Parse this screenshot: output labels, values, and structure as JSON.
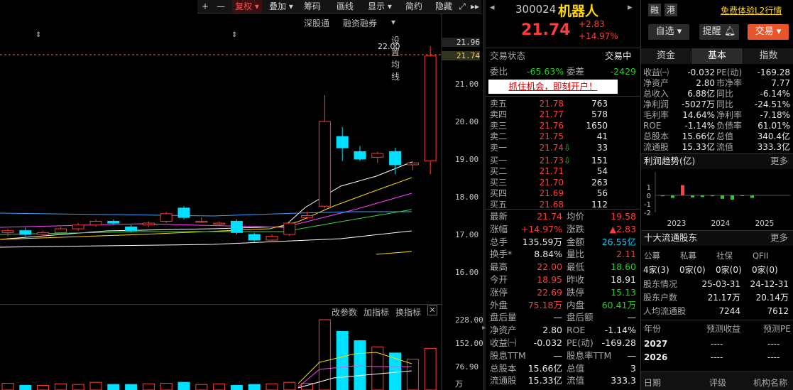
{
  "toolbar": {
    "items": [
      "+",
      "—",
      "复权",
      "叠加",
      "筹码",
      "画线",
      "显示",
      "简约",
      "隐藏"
    ]
  },
  "subbar": {
    "items": [
      "深股通",
      "融资融券",
      "设置均线"
    ]
  },
  "price_axis": {
    "labels": [
      "22.00",
      "21.00",
      "20.00",
      "19.00",
      "18.00",
      "17.00",
      "16.00"
    ],
    "tags": [
      "21.96",
      "21.74"
    ],
    "high_marker": "22.00"
  },
  "volume_bar": {
    "items": [
      "改参数",
      "加指标",
      "换指标"
    ],
    "labels": [
      "228.00",
      "152.00",
      "76.90",
      "万"
    ]
  },
  "chart_data": {
    "type": "candlestick",
    "candles": [
      {
        "o": 17.05,
        "c": 17.1,
        "h": 17.15,
        "l": 16.95
      },
      {
        "o": 17.1,
        "c": 17.0,
        "h": 17.18,
        "l": 16.95
      },
      {
        "o": 17.0,
        "c": 17.05,
        "h": 17.1,
        "l": 16.95
      },
      {
        "o": 17.05,
        "c": 17.15,
        "h": 17.2,
        "l": 17.0
      },
      {
        "o": 17.15,
        "c": 17.25,
        "h": 17.3,
        "l": 17.1
      },
      {
        "o": 17.25,
        "c": 17.35,
        "h": 17.4,
        "l": 17.2
      },
      {
        "o": 17.35,
        "c": 17.3,
        "h": 17.4,
        "l": 17.25
      },
      {
        "o": 17.2,
        "c": 17.1,
        "h": 17.25,
        "l": 17.05
      },
      {
        "o": 17.25,
        "c": 17.3,
        "h": 17.35,
        "l": 17.2
      },
      {
        "o": 17.35,
        "c": 17.55,
        "h": 17.6,
        "l": 17.3
      },
      {
        "o": 17.7,
        "c": 17.45,
        "h": 17.75,
        "l": 17.4
      },
      {
        "o": 17.35,
        "c": 17.35,
        "h": 17.45,
        "l": 17.3
      },
      {
        "o": 17.3,
        "c": 17.3,
        "h": 17.35,
        "l": 17.25
      },
      {
        "o": 17.35,
        "c": 17.05,
        "h": 17.4,
        "l": 17.0
      },
      {
        "o": 17.0,
        "c": 16.85,
        "h": 17.05,
        "l": 16.8
      },
      {
        "o": 16.85,
        "c": 16.95,
        "h": 17.0,
        "l": 16.8
      },
      {
        "o": 17.0,
        "c": 17.3,
        "h": 17.35,
        "l": 16.95
      },
      {
        "o": 17.45,
        "c": 17.5,
        "h": 17.6,
        "l": 17.4
      },
      {
        "o": 17.75,
        "c": 20.0,
        "h": 20.7,
        "l": 17.7
      },
      {
        "o": 19.6,
        "c": 19.3,
        "h": 19.85,
        "l": 18.95
      },
      {
        "o": 19.2,
        "c": 19.0,
        "h": 19.35,
        "l": 18.95
      },
      {
        "o": 19.05,
        "c": 19.15,
        "h": 19.2,
        "l": 18.9
      },
      {
        "o": 19.2,
        "c": 18.85,
        "h": 19.3,
        "l": 18.6
      },
      {
        "o": 18.85,
        "c": 18.9,
        "h": 18.95,
        "l": 18.7
      },
      {
        "o": 18.95,
        "c": 21.74,
        "h": 22.0,
        "l": 18.6
      }
    ],
    "volume": [
      22,
      15,
      15,
      20,
      18,
      25,
      18,
      18,
      20,
      22,
      25,
      18,
      20,
      15,
      18,
      20,
      25,
      22,
      228,
      190,
      160,
      140,
      120,
      100,
      135
    ]
  },
  "quote": {
    "code": "300024",
    "name": "机器人",
    "price": "21.74",
    "change": "+2.83",
    "pct": "+14.97%",
    "btn_zixuan": "自选",
    "btn_tixing": "提醒",
    "btn_jiaoyi": "交易",
    "state_label": "交易状态",
    "state_value": "交易中",
    "weibi_label": "委比",
    "weibi": "-65.63%",
    "weicha_label": "委差",
    "weicha": "-2429",
    "ad": "抓住机会，即刻开户！",
    "sells": [
      {
        "label": "卖五",
        "price": "21.78",
        "vol": "763"
      },
      {
        "label": "卖四",
        "price": "21.77",
        "vol": "578"
      },
      {
        "label": "卖三",
        "price": "21.76",
        "vol": "1650"
      },
      {
        "label": "卖二",
        "price": "21.75",
        "vol": "41"
      },
      {
        "label": "卖一",
        "price": "21.74",
        "vol": "33"
      }
    ],
    "buys": [
      {
        "label": "买一",
        "price": "21.73",
        "vol": "151"
      },
      {
        "label": "买二",
        "price": "21.71",
        "vol": "54"
      },
      {
        "label": "买三",
        "price": "21.70",
        "vol": "263"
      },
      {
        "label": "买四",
        "price": "21.69",
        "vol": "56"
      },
      {
        "label": "买五",
        "price": "21.68",
        "vol": "112"
      }
    ],
    "stats": [
      [
        "最新",
        "21.74",
        "均价",
        "19.58"
      ],
      [
        "涨幅",
        "+14.97%",
        "涨跌",
        "▲2.83"
      ],
      [
        "总手",
        "135.59万",
        "金额",
        "26.55亿"
      ],
      [
        "换手*",
        "8.84%",
        "量比",
        "2.11"
      ],
      [
        "最高",
        "22.00",
        "最低",
        "18.60"
      ],
      [
        "今开",
        "18.95",
        "昨收",
        "18.91"
      ],
      [
        "涨停",
        "22.69",
        "跌停",
        "15.13"
      ],
      [
        "外盘",
        "75.18万",
        "内盘",
        "60.41万"
      ],
      [
        "盘后量",
        "—",
        "盘后额",
        "—"
      ],
      [
        "净资产",
        "2.80",
        "ROE",
        "-1.14%"
      ],
      [
        "收益㈠",
        "-0.032",
        "PE(动)",
        "-169.28"
      ],
      [
        "股息TTM",
        "—",
        "股息率TTM",
        "—"
      ],
      [
        "总股本",
        "15.66亿",
        "总值",
        "3"
      ],
      [
        "流通股",
        "15.33亿",
        "流值",
        "333.3"
      ]
    ]
  },
  "fin": {
    "header_rz": "融",
    "header_gang": "港",
    "header_l2": "免费体验L2行情",
    "tabs": [
      "资金",
      "基本",
      "指数"
    ],
    "rows": [
      [
        "收益㈠",
        "-0.032",
        "PE(动)",
        "-169.28"
      ],
      [
        "净资产",
        "2.80",
        "市净率",
        "7.77"
      ],
      [
        "总收入",
        "6.88亿",
        "同比",
        "-6.14%"
      ],
      [
        "净利润",
        "-5027万",
        "同比",
        "-24.51%"
      ],
      [
        "毛利率",
        "14.64%",
        "净利率",
        "-7.18%"
      ],
      [
        "ROE",
        "-1.14%",
        "负债率",
        "61.01%"
      ],
      [
        "总股本",
        "15.66亿",
        "总值",
        "340.4亿"
      ],
      [
        "流通股",
        "15.33亿",
        "流值",
        "333.3亿"
      ]
    ],
    "profit_title": "利润趋势(亿)",
    "more": "更多",
    "profit_axis": [
      "1",
      "0",
      "-1",
      "-2"
    ],
    "profit_years": [
      "2023",
      "2024",
      "2025"
    ],
    "profit_values": [
      -0.1,
      -0.3,
      1.2,
      -0.25,
      -0.2,
      -0.1,
      -0.4,
      -0.5,
      -0.05,
      -0.3
    ],
    "holders_title": "十大流通股东",
    "holder_heads": [
      "公募",
      "私募",
      "社保",
      "QFII"
    ],
    "holder_vals": [
      "4家(3)",
      "0家(0)",
      "0家(0)",
      "0家(0)"
    ],
    "holder_rows": [
      [
        "股东情况",
        "25-03-31",
        "24-12-31"
      ],
      [
        "股东户数",
        "21.17万",
        "20.14万"
      ],
      [
        "人均流通股",
        "7244",
        "7612"
      ]
    ],
    "forecast_heads": [
      "年份",
      "预测收益",
      "预测PE"
    ],
    "forecast_rows": [
      [
        "2027",
        "----",
        "----"
      ],
      [
        "2026",
        "----",
        "----"
      ]
    ],
    "bottom": [
      "日期",
      "评级",
      "机构名称"
    ]
  }
}
